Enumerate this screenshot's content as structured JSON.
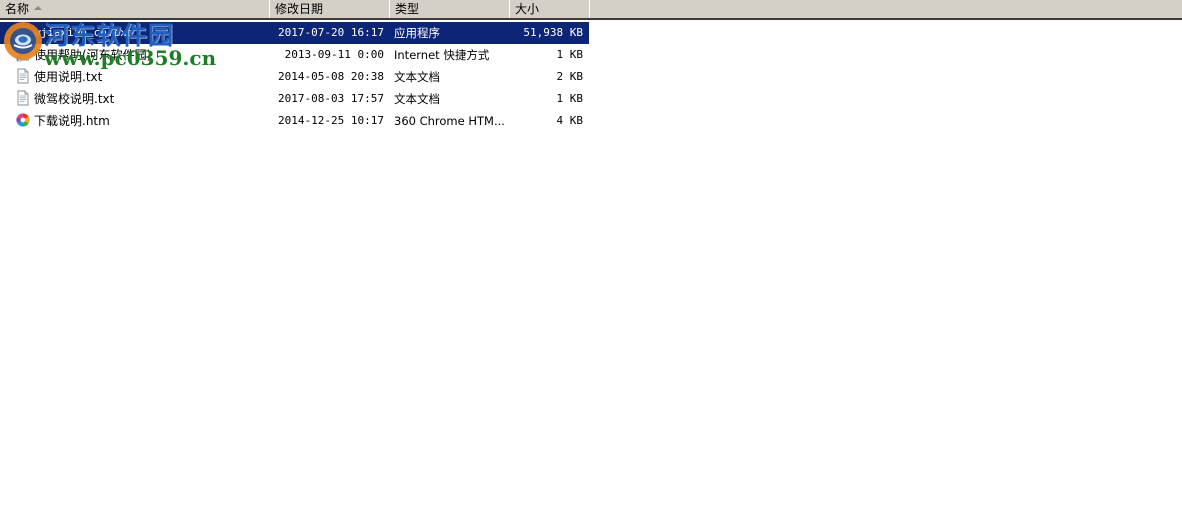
{
  "window": {
    "background_color": "#ffffff",
    "header_background": "#d4d0c8",
    "selection_color": "#0c2577"
  },
  "columns": [
    {
      "key": "name",
      "label": "名称",
      "sorted": "ascending"
    },
    {
      "key": "modified",
      "label": "修改日期",
      "sorted": "none"
    },
    {
      "key": "type",
      "label": "类型",
      "sorted": "none"
    },
    {
      "key": "size",
      "label": "大小",
      "sorted": "none"
    }
  ],
  "files": [
    {
      "name": "wjiaxiao_cn.exe",
      "modified": "2017-07-20 16:17",
      "type": "应用程序",
      "size": "51,938 KB",
      "icon": "application-exe-icon",
      "selected": true
    },
    {
      "name": "使用帮助(河东软件园)",
      "modified": "2013-09-11 0:00",
      "type": "Internet 快捷方式",
      "size": "1 KB",
      "icon": "internet-shortcut-icon",
      "selected": false
    },
    {
      "name": "使用说明.txt",
      "modified": "2014-05-08 20:38",
      "type": "文本文档",
      "size": "2 KB",
      "icon": "text-document-icon",
      "selected": false
    },
    {
      "name": "微驾校说明.txt",
      "modified": "2017-08-03 17:57",
      "type": "文本文档",
      "size": "1 KB",
      "icon": "text-document-icon",
      "selected": false
    },
    {
      "name": "下载说明.htm",
      "modified": "2014-12-25 10:17",
      "type": "360 Chrome HTM...",
      "size": "4 KB",
      "icon": "chrome-html-icon",
      "selected": false
    }
  ],
  "watermark": {
    "site_name": "河东软件园",
    "url": "www.pc0359.cn",
    "logo": "hedong-logo-icon",
    "text_color": "#1f5fbf",
    "url_color": "#1f7d27"
  }
}
